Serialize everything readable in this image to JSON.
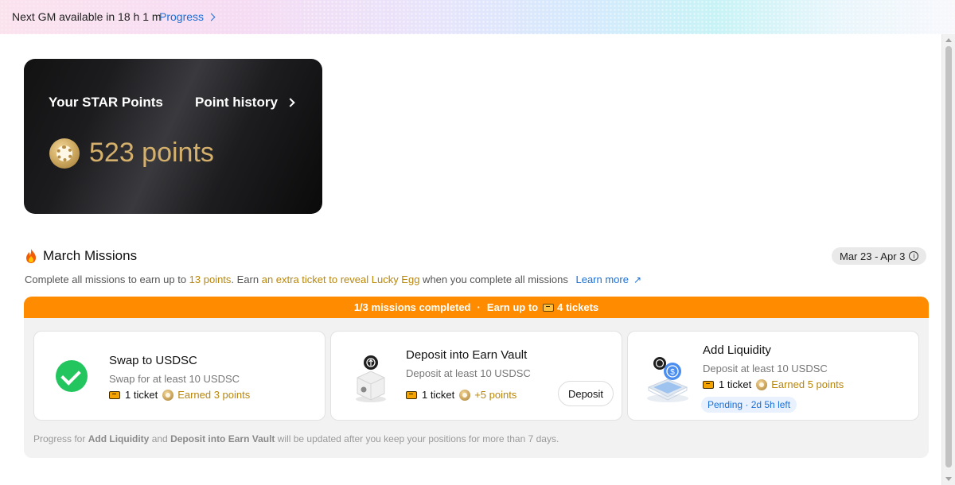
{
  "banner": {
    "gm_text": "Next GM available in 18 h 1 m",
    "progress_link": "Progress"
  },
  "points_card": {
    "title": "Your STAR Points",
    "history_link": "Point history",
    "points": "523 points"
  },
  "missions": {
    "title": "March Missions",
    "date_range": "Mar 23 - Apr 3",
    "subtitle": {
      "part1": "Complete all missions to earn up to ",
      "points": "13 points",
      "part2": ". Earn ",
      "extra": "an extra ticket to reveal Lucky Egg",
      "part3": " when you complete all missions",
      "learn_more": "Learn more"
    },
    "progress_bar": {
      "completed": "1/3 missions completed",
      "earn_prefix": "Earn up to",
      "tickets": "4 tickets"
    },
    "cards": [
      {
        "title": "Swap to USDSC",
        "subtitle": "Swap for at least 10 USDSC",
        "ticket": "1 ticket",
        "reward": "Earned 3 points",
        "status": "completed"
      },
      {
        "title": "Deposit into Earn Vault",
        "subtitle": "Deposit at least 10 USDSC",
        "ticket": "1 ticket",
        "reward": "+5 points",
        "button": "Deposit"
      },
      {
        "title": "Add Liquidity",
        "subtitle": "Deposit at least 10 USDSC",
        "ticket": "1 ticket",
        "reward": "Earned 5 points",
        "pending": "Pending · 2d 5h left"
      }
    ],
    "footnote": {
      "part1": "Progress for ",
      "item1": "Add Liquidity",
      "part2": " and ",
      "item2": "Deposit into Earn Vault",
      "part3": " will be updated after you keep your positions for more than 7 days."
    }
  },
  "colors": {
    "accent_orange": "#ff8c00",
    "gold": "#b8860b",
    "link_blue": "#1a6fd8",
    "success_green": "#22c55e"
  },
  "icons": [
    "chevron-right-icon",
    "star-coin-icon",
    "flame-icon",
    "info-icon",
    "arrow-up-right-icon",
    "ticket-icon",
    "check-icon",
    "vault-icon",
    "liquidity-icon"
  ]
}
